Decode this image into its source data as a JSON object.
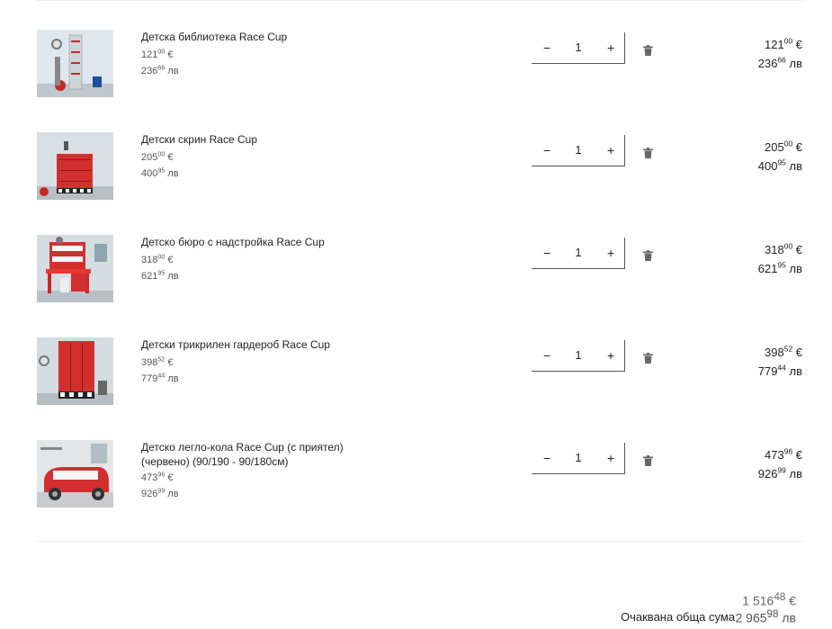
{
  "items": [
    {
      "name": "Детска библиотека Race Cup",
      "unit_eur_int": "121",
      "unit_eur_dec": "00",
      "eur_sign": "€",
      "unit_bgn_int": "236",
      "unit_bgn_dec": "66",
      "bgn_sign": "лв",
      "qty": "1",
      "minus": "−",
      "plus": "+",
      "tot_eur_int": "121",
      "tot_eur_dec": "00",
      "tot_bgn_int": "236",
      "tot_bgn_dec": "66"
    },
    {
      "name": "Детски скрин Race Cup",
      "unit_eur_int": "205",
      "unit_eur_dec": "00",
      "eur_sign": "€",
      "unit_bgn_int": "400",
      "unit_bgn_dec": "95",
      "bgn_sign": "лв",
      "qty": "1",
      "minus": "−",
      "plus": "+",
      "tot_eur_int": "205",
      "tot_eur_dec": "00",
      "tot_bgn_int": "400",
      "tot_bgn_dec": "95"
    },
    {
      "name": "Детско бюро с надстройка Race Cup",
      "unit_eur_int": "318",
      "unit_eur_dec": "00",
      "eur_sign": "€",
      "unit_bgn_int": "621",
      "unit_bgn_dec": "95",
      "bgn_sign": "лв",
      "qty": "1",
      "minus": "−",
      "plus": "+",
      "tot_eur_int": "318",
      "tot_eur_dec": "00",
      "tot_bgn_int": "621",
      "tot_bgn_dec": "95"
    },
    {
      "name": "Детски трикрилен гардероб Race Cup",
      "unit_eur_int": "398",
      "unit_eur_dec": "52",
      "eur_sign": "€",
      "unit_bgn_int": "779",
      "unit_bgn_dec": "44",
      "bgn_sign": "лв",
      "qty": "1",
      "minus": "−",
      "plus": "+",
      "tot_eur_int": "398",
      "tot_eur_dec": "52",
      "tot_bgn_int": "779",
      "tot_bgn_dec": "44"
    },
    {
      "name": "Детско легло-кола Race Cup (с приятел) (червено) (90/190 - 90/180см)",
      "unit_eur_int": "473",
      "unit_eur_dec": "96",
      "eur_sign": "€",
      "unit_bgn_int": "926",
      "unit_bgn_dec": "99",
      "bgn_sign": "лв",
      "qty": "1",
      "minus": "−",
      "plus": "+",
      "tot_eur_int": "473",
      "tot_eur_dec": "96",
      "tot_bgn_int": "926",
      "tot_bgn_dec": "99"
    }
  ],
  "footer": {
    "label": "Очаквана обща сума",
    "eur_int": "1 516",
    "eur_dec": "48",
    "eur_sign": "€",
    "bgn_int": "2 965",
    "bgn_dec": "98",
    "bgn_sign": "лв"
  },
  "icons": {
    "trash": "trash-icon"
  }
}
